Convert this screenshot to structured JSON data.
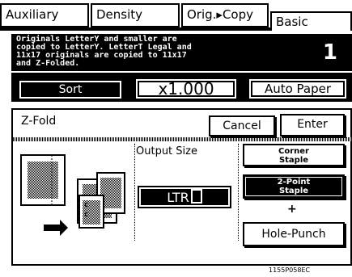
{
  "tabs": [
    {
      "label": "Auxiliary",
      "active": false
    },
    {
      "label": "Density",
      "active": false
    },
    {
      "label": "Orig.▸Copy",
      "active": false
    },
    {
      "label": "Basic",
      "active": true
    }
  ],
  "banner": {
    "message": "Originals LetterY and smaller are\ncopied to LetterY. LetterT Legal and\n11x17 originals are copied to 11x17\nand Z-Folded.",
    "copy_count": "1"
  },
  "controls": {
    "sort_label": "Sort",
    "zoom_label": "x1.000",
    "paper_label": "Auto Paper"
  },
  "panel": {
    "title": "Z-Fold",
    "cancel_label": "Cancel",
    "enter_label": "Enter",
    "output_size_label": "Output Size",
    "output_size_value": "LTR",
    "options": {
      "corner_staple": "Corner\nStaple",
      "two_point_staple": "2-Point\nStaple",
      "plus": "+",
      "hole_punch": "Hole-Punch"
    }
  },
  "footer_code": "1155P058EC",
  "icons": [
    "z-fold-illustration-icon",
    "arrow-right-icon"
  ]
}
